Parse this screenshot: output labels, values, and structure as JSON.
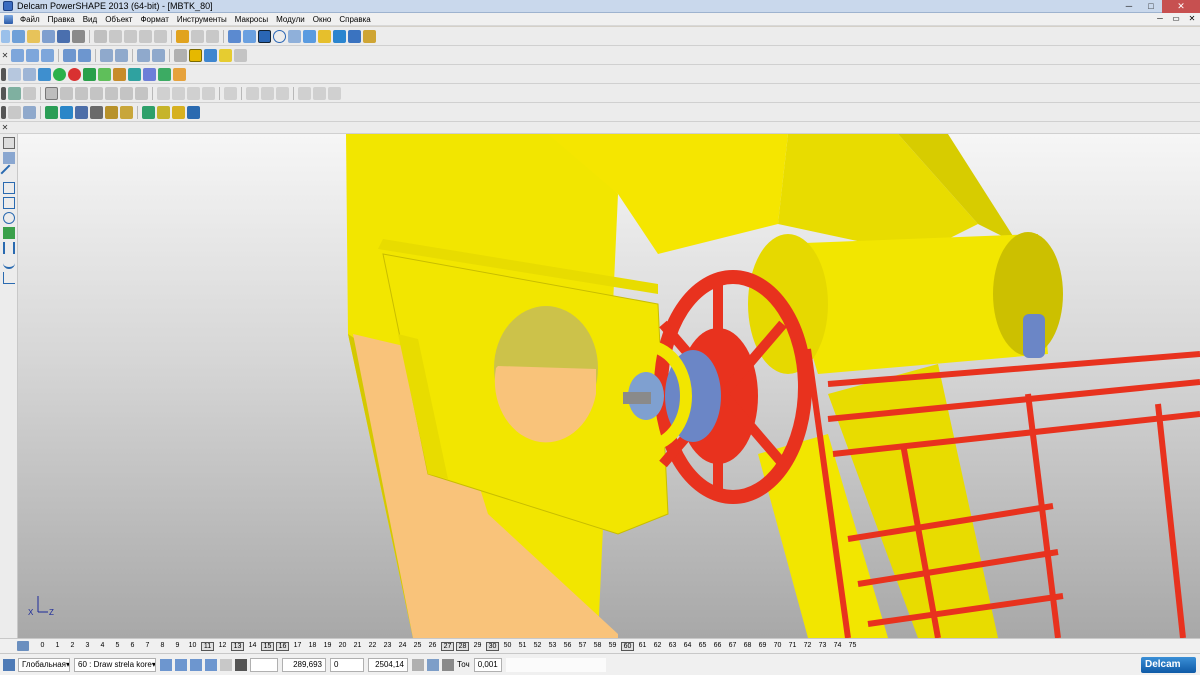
{
  "window": {
    "title": "Delcam PowerSHAPE 2013 (64-bit) - [MBTK_80]",
    "minimize": "─",
    "maximize": "□",
    "close": "✕"
  },
  "menu": {
    "items": [
      "Файл",
      "Правка",
      "Вид",
      "Объект",
      "Формат",
      "Инструменты",
      "Макросы",
      "Модули",
      "Окно",
      "Справка"
    ],
    "mdi": [
      "─",
      "▭",
      "✕"
    ]
  },
  "colors": {
    "model_yellow": "#f2e600",
    "model_orange": "#f9c37a",
    "model_red": "#e8321e",
    "model_blue": "#6b86c6"
  },
  "levels": {
    "numbers": [
      "0",
      "1",
      "2",
      "3",
      "4",
      "5",
      "6",
      "7",
      "8",
      "9",
      "10",
      "11",
      "12",
      "13",
      "14",
      "15",
      "16",
      "17",
      "18",
      "19",
      "20",
      "21",
      "22",
      "23",
      "24",
      "25",
      "26",
      "27",
      "28",
      "29",
      "30",
      "50",
      "51",
      "52",
      "53",
      "56",
      "57",
      "58",
      "59",
      "60",
      "61",
      "62",
      "63",
      "64",
      "65",
      "66",
      "67",
      "68",
      "69",
      "70",
      "71",
      "72",
      "73",
      "74",
      "75"
    ],
    "selected": [
      "11",
      "13",
      "15",
      "16",
      "27",
      "28",
      "30",
      "60"
    ]
  },
  "status": {
    "workplane": "Глобальная",
    "level": "60 : Draw strela kore",
    "x": "289,693",
    "y": "0",
    "z": "2504,14",
    "tolerance_label": "Точ",
    "tolerance": "0,001",
    "message": ""
  },
  "brand": "Delcam",
  "axes": {
    "x": "X",
    "z": "Z"
  }
}
